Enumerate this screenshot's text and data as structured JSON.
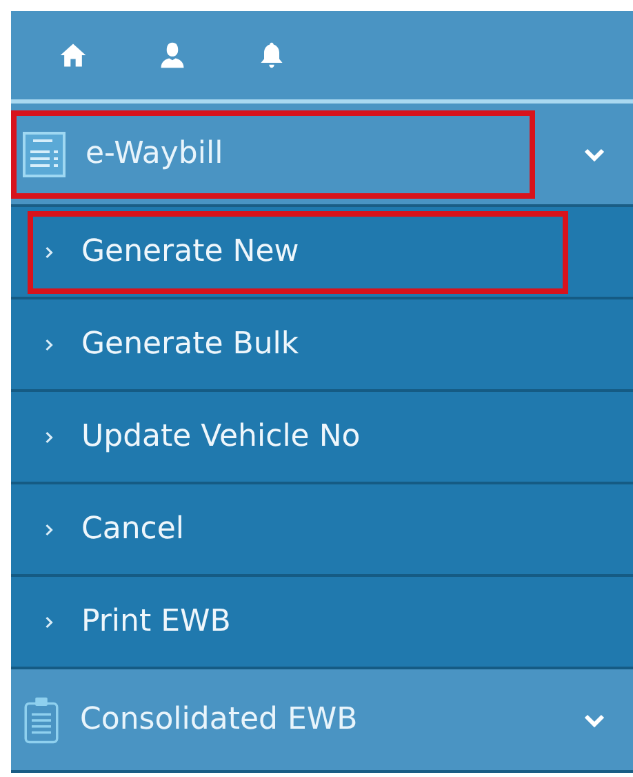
{
  "sections": [
    {
      "title": "e-Waybill",
      "highlighted": true,
      "items": [
        {
          "label": "Generate New",
          "highlighted": true
        },
        {
          "label": "Generate Bulk",
          "highlighted": false
        },
        {
          "label": "Update Vehicle No",
          "highlighted": false
        },
        {
          "label": "Cancel",
          "highlighted": false
        },
        {
          "label": "Print EWB",
          "highlighted": false
        }
      ]
    },
    {
      "title": "Consolidated EWB",
      "highlighted": false
    }
  ]
}
